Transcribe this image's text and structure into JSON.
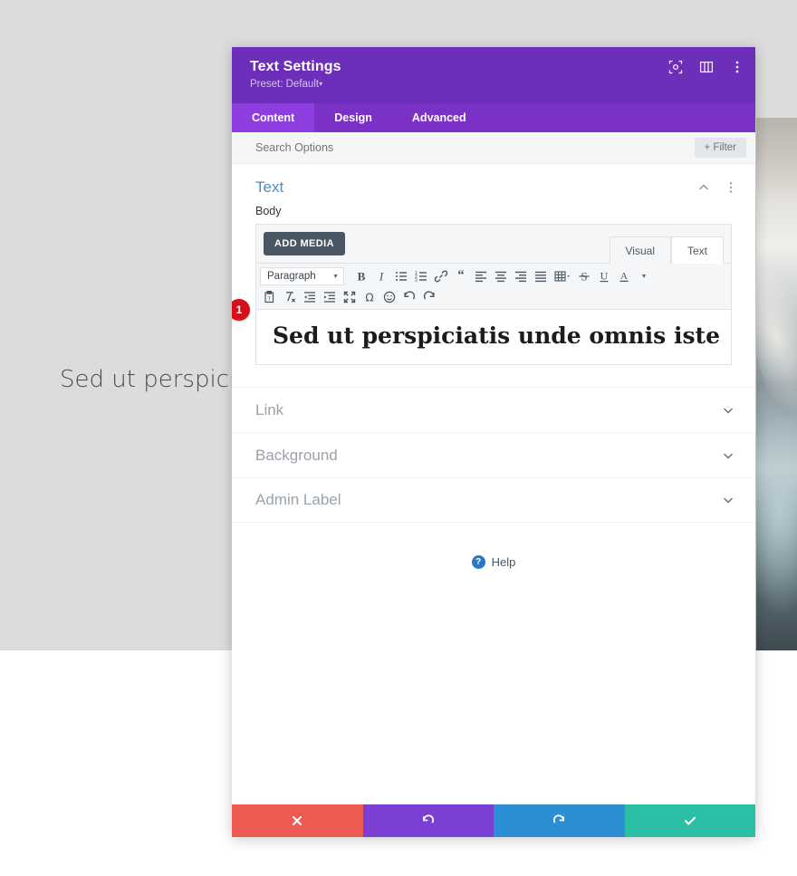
{
  "page": {
    "body_text": "Sed ut perspiciat",
    "photo_alt": "pussy-willow-branches-in-glass-jar-photo"
  },
  "modal": {
    "title": "Text Settings",
    "preset_label": "Preset: Default",
    "header_icons": [
      {
        "name": "focus-target-icon"
      },
      {
        "name": "layout-columns-icon"
      },
      {
        "name": "more-vertical-icon"
      }
    ],
    "tabs": [
      {
        "label": "Content",
        "active": true
      },
      {
        "label": "Design",
        "active": false
      },
      {
        "label": "Advanced",
        "active": false
      }
    ],
    "search": {
      "placeholder": "Search Options",
      "value": "",
      "filter_label": "+ Filter"
    },
    "group": {
      "title": "Text",
      "collapse_icon": "chevron-up-icon",
      "menu_icon": "more-vertical-icon"
    },
    "field": {
      "label": "Body",
      "add_media_label": "ADD MEDIA",
      "editor_modes": [
        {
          "label": "Visual",
          "active": true
        },
        {
          "label": "Text",
          "active": false
        }
      ],
      "toolbar_row1": [
        {
          "name": "paragraph-format-select",
          "label": "Paragraph"
        },
        {
          "name": "bold-icon",
          "label": "B"
        },
        {
          "name": "italic-icon",
          "label": "I"
        },
        {
          "name": "bulleted-list-icon",
          "label": ""
        },
        {
          "name": "numbered-list-icon",
          "label": ""
        },
        {
          "name": "link-icon",
          "label": ""
        },
        {
          "name": "blockquote-icon",
          "label": "“"
        },
        {
          "name": "align-left-icon",
          "label": ""
        },
        {
          "name": "align-center-icon",
          "label": ""
        },
        {
          "name": "align-right-icon",
          "label": ""
        },
        {
          "name": "align-justify-icon",
          "label": ""
        },
        {
          "name": "table-icon",
          "label": ""
        },
        {
          "name": "strikethrough-icon",
          "label": "S"
        },
        {
          "name": "underline-icon",
          "label": "U"
        },
        {
          "name": "text-color-icon",
          "label": "A"
        }
      ],
      "toolbar_row2": [
        {
          "name": "paste-as-text-icon",
          "label": ""
        },
        {
          "name": "clear-formatting-icon",
          "label": ""
        },
        {
          "name": "outdent-icon",
          "label": ""
        },
        {
          "name": "indent-icon",
          "label": ""
        },
        {
          "name": "fullscreen-icon",
          "label": ""
        },
        {
          "name": "special-character-icon",
          "label": "Ω"
        },
        {
          "name": "emoji-icon",
          "label": ""
        },
        {
          "name": "undo-icon",
          "label": ""
        },
        {
          "name": "redo-icon",
          "label": ""
        }
      ],
      "content": "Sed ut perspiciatis unde omnis iste",
      "badge": "1"
    },
    "sections": [
      {
        "label": "Link",
        "icon": "chevron-down-icon"
      },
      {
        "label": "Background",
        "icon": "chevron-down-icon"
      },
      {
        "label": "Admin Label",
        "icon": "chevron-down-icon"
      }
    ],
    "help": {
      "icon": "question-mark-icon",
      "label": "Help"
    },
    "footer_buttons": [
      {
        "name": "discard-button",
        "icon": "close-icon",
        "color": "#ed5a52"
      },
      {
        "name": "undo-button",
        "icon": "undo-icon",
        "color": "#7b3fd3"
      },
      {
        "name": "redo-button",
        "icon": "redo-icon",
        "color": "#2c8fd6"
      },
      {
        "name": "save-button",
        "icon": "check-icon",
        "color": "#2bbfa5"
      }
    ]
  },
  "colors": {
    "header_purple": "#6d2eb9",
    "tabbar_purple": "#7b30c6",
    "active_tab_purple": "#8e3ddf",
    "group_title_blue": "#4c8bbd",
    "badge_red": "#d4111b",
    "help_blue": "#2879c4"
  }
}
